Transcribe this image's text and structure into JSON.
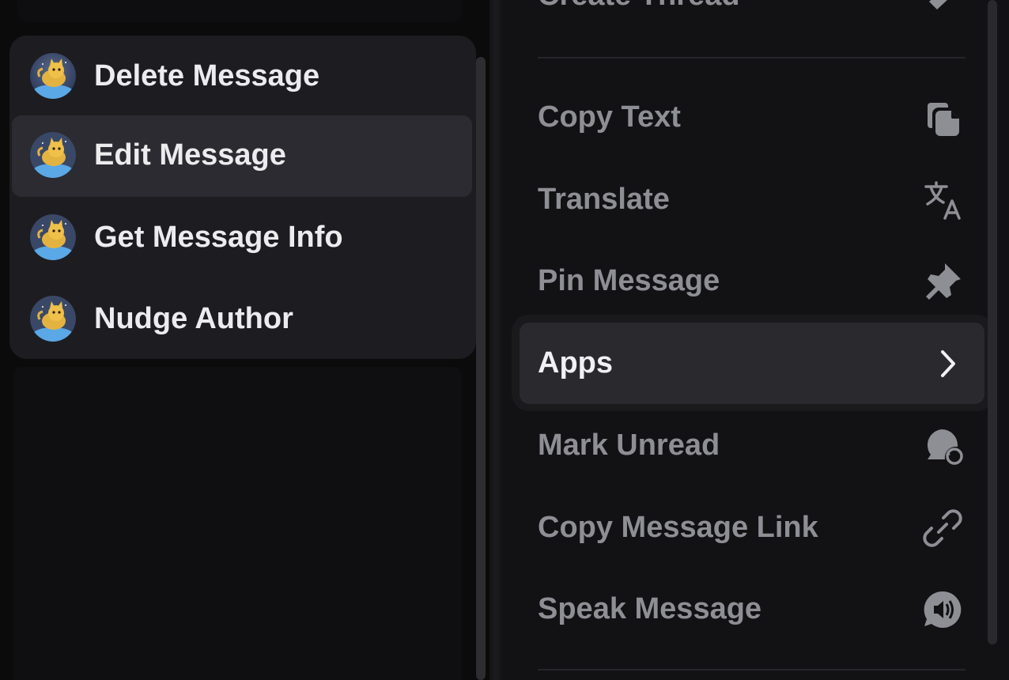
{
  "apps_submenu": {
    "items": [
      {
        "label": "Delete Message",
        "highlighted": false
      },
      {
        "label": "Edit Message",
        "highlighted": true
      },
      {
        "label": "Get Message Info",
        "highlighted": false
      },
      {
        "label": "Nudge Author",
        "highlighted": false
      }
    ],
    "avatar_icon": "cat-bot-avatar"
  },
  "context_menu": {
    "partial_top_item": {
      "label": "Create Thread",
      "icon": "thread-icon"
    },
    "items": [
      {
        "label": "Copy Text",
        "icon": "copy-icon"
      },
      {
        "label": "Translate",
        "icon": "translate-icon"
      },
      {
        "label": "Pin Message",
        "icon": "pin-icon"
      },
      {
        "label": "Apps",
        "icon": "chevron-right-icon",
        "active": true
      },
      {
        "label": "Mark Unread",
        "icon": "mark-unread-icon"
      },
      {
        "label": "Copy Message Link",
        "icon": "link-icon"
      },
      {
        "label": "Speak Message",
        "icon": "speak-icon"
      }
    ]
  },
  "colors": {
    "background": "#0b0b0c",
    "menu_background": "#121214",
    "submenu_background": "#1d1d21",
    "highlight": "#2b2b31",
    "text_primary": "#ececee",
    "text_muted": "#8e8e95"
  }
}
